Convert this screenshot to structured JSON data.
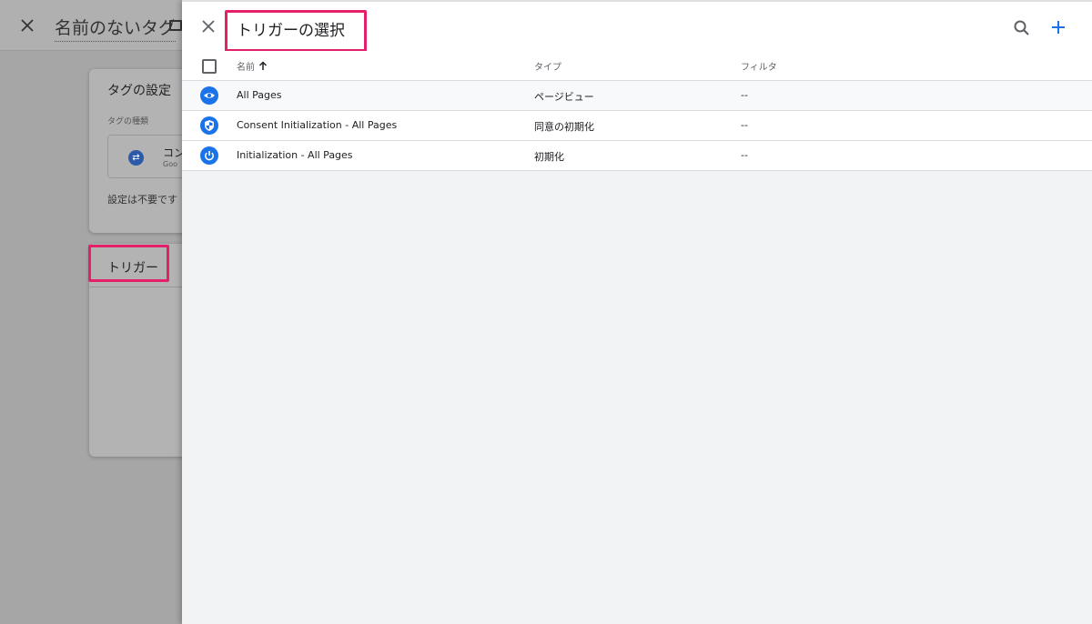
{
  "background_editor": {
    "title": "名前のないタグ",
    "config_card": {
      "title": "タグの設定",
      "type_label": "タグの種類",
      "type_name": "コン",
      "type_sub": "Goo",
      "note": "設定は不要です"
    },
    "trigger_card": {
      "title": "トリガー"
    }
  },
  "panel": {
    "title": "トリガーの選択",
    "table": {
      "columns": {
        "name": "名前",
        "type": "タイプ",
        "filter": "フィルタ"
      },
      "rows": [
        {
          "icon": "eye-icon",
          "name": "All Pages",
          "type": "ページビュー",
          "filter": "--"
        },
        {
          "icon": "shield-icon",
          "name": "Consent Initialization - All Pages",
          "type": "同意の初期化",
          "filter": "--"
        },
        {
          "icon": "power-icon",
          "name": "Initialization - All Pages",
          "type": "初期化",
          "filter": "--"
        }
      ]
    }
  },
  "colors": {
    "highlight": "#e4206a",
    "accent": "#1a73e8"
  }
}
